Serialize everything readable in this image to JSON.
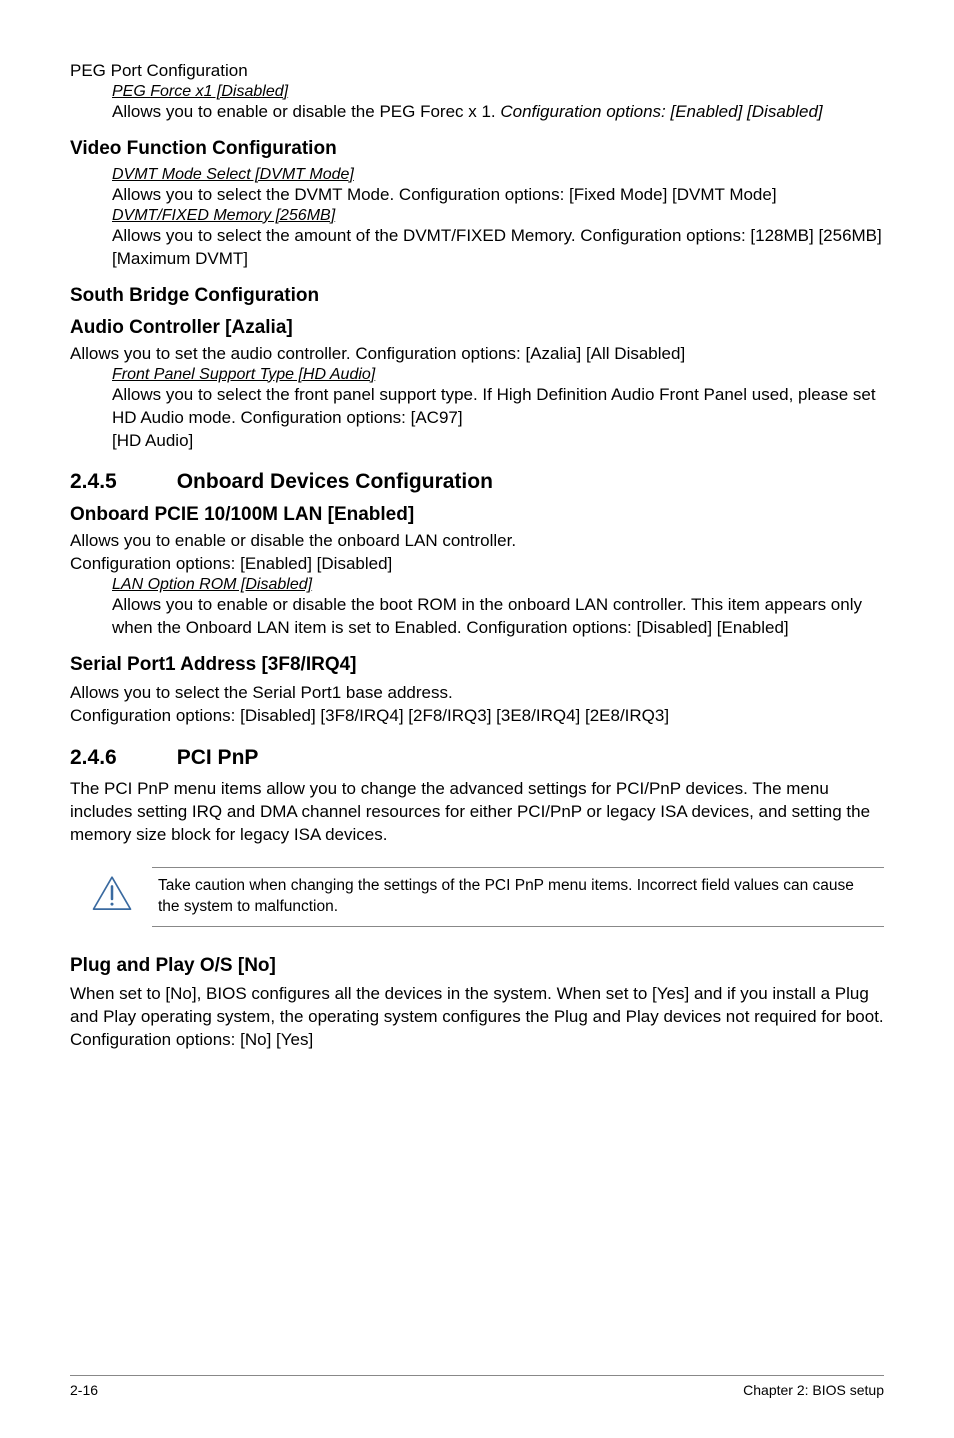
{
  "peg": {
    "title": "PEG Port Configuration",
    "opt_head": "PEG Force x1 [Disabled]",
    "opt_text1": "Allows you to enable or disable the PEG Forec x 1. ",
    "opt_text2": "Configuration options: [Enabled] [Disabled]"
  },
  "video": {
    "title": "Video Function Configuration",
    "dvmt_head": "DVMT Mode Select [DVMT Mode]",
    "dvmt_text": "Allows you to select the DVMT Mode. Configuration options: [Fixed Mode] [DVMT Mode]",
    "mem_head": "DVMT/FIXED Memory [256MB]",
    "mem_text": "Allows you to select the amount of the DVMT/FIXED Memory. Configuration options: [128MB] [256MB] [Maximum DVMT]"
  },
  "south": {
    "title": "South Bridge Configuration"
  },
  "audio": {
    "title": "Audio Controller [Azalia]",
    "text": "Allows you to set the audio controller. Configuration options: [Azalia] [All Disabled]",
    "fp_head": " Front Panel Support Type [HD Audio]",
    "fp_text1": "Allows you to select the front panel support type. If High Definition Audio Front Panel used, please set HD Audio mode. Configuration options: [AC97]",
    "fp_text2": "[HD Audio]"
  },
  "s245": {
    "num": "2.4.5",
    "title": "Onboard Devices Configuration"
  },
  "pcie": {
    "title": "Onboard PCIE 10/100M LAN [Enabled]",
    "text1": "Allows you to enable or disable the onboard LAN controller.",
    "text2": "Configuration options: [Enabled] [Disabled]",
    "lan_head": "LAN Option ROM [Disabled]",
    "lan_text": "Allows you to enable or disable the boot ROM in the onboard LAN controller. This item appears only when the Onboard LAN item is set to Enabled. Configuration options: [Disabled] [Enabled]"
  },
  "serial": {
    "title": "Serial Port1 Address [3F8/IRQ4]",
    "text1": "Allows you to select the Serial Port1 base address.",
    "text2": "Configuration options: [Disabled] [3F8/IRQ4] [2F8/IRQ3] [3E8/IRQ4] [2E8/IRQ3]"
  },
  "s246": {
    "num": "2.4.6",
    "title": "PCI PnP",
    "text": "The PCI PnP menu items allow you to change the advanced settings for PCI/PnP devices. The menu includes setting IRQ and DMA channel resources for either PCI/PnP or legacy ISA devices, and setting the memory size block for legacy ISA devices."
  },
  "callout": {
    "text": "Take caution when changing the settings of the PCI PnP menu items. Incorrect field values can cause the system to malfunction."
  },
  "plug": {
    "title": "Plug and Play O/S [No]",
    "text1": "When set to [No], BIOS configures all the devices in the system. When set to [Yes] and if you install a Plug and Play operating system, the operating system configures the Plug and Play devices not required for boot.",
    "text2": "Configuration options: [No] [Yes]"
  },
  "footer": {
    "left": "2-16",
    "right": "Chapter 2: BIOS setup"
  }
}
